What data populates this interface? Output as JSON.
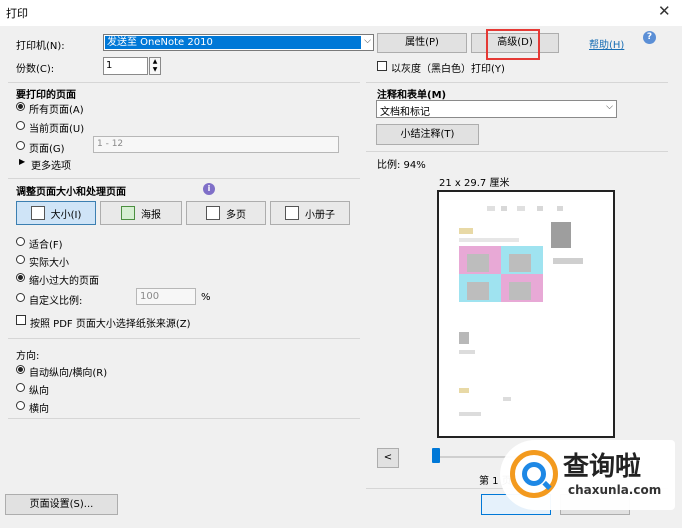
{
  "window": {
    "title": "打印",
    "close": "✕"
  },
  "printer": {
    "label": "打印机(N):",
    "selected": "发送至 OneNote 2010",
    "properties": "属性(P)",
    "advanced": "高级(D)",
    "help": "帮助(H)",
    "copies_label": "份数(C):",
    "copies_value": "1",
    "grayscale": "以灰度（黑白色）打印(Y)"
  },
  "pages_to_print": {
    "title": "要打印的页面",
    "all": "所有页面(A)",
    "current": "当前页面(U)",
    "pages": "页面(G)",
    "pages_placeholder": "1 - 12",
    "more": "更多选项"
  },
  "page_sizing": {
    "title": "调整页面大小和处理页面",
    "size": "大小(I)",
    "poster": "海报",
    "multiple": "多页",
    "booklet": "小册子",
    "fit": "适合(F)",
    "actual": "实际大小",
    "shrink": "缩小过大的页面",
    "custom": "自定义比例:",
    "custom_value": "100",
    "percent": "%",
    "pdf_source": "按照 PDF 页面大小选择纸张来源(Z)"
  },
  "orientation": {
    "title": "方向:",
    "auto": "自动纵向/横向(R)",
    "portrait": "纵向",
    "landscape": "横向"
  },
  "comments": {
    "title": "注释和表单(M)",
    "selected": "文档和标记",
    "summarize": "小结注释(T)"
  },
  "preview": {
    "scale": "比例:   94%",
    "size": "21 x 29.7 厘米",
    "prev": "<",
    "page_info": "第 1 页"
  },
  "footer": {
    "page_setup": "页面设置(S)..."
  },
  "watermark": {
    "brand": "查询啦",
    "url": "chaxunla.com"
  },
  "colors": {
    "highlight": "#e53935",
    "selection": "#0078d7",
    "accent": "#1a6fb5"
  }
}
